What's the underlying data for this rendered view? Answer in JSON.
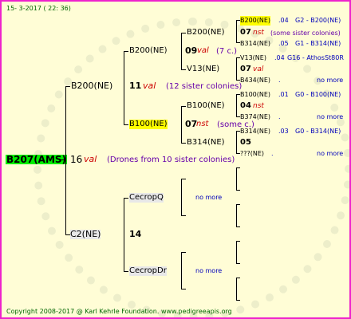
{
  "header": {
    "date": "15- 3-2017 ( 22: 36)"
  },
  "footer": {
    "copyright": "Copyright 2008-2017 @ Karl Kehrle Foundation.   www.pedigreeapis.org"
  },
  "root": {
    "id": "B207(AMS)",
    "num": "16",
    "tag": "val",
    "note": "(Drones from 10 sister colonies)"
  },
  "sire": {
    "id": "B200(NE)",
    "num": "11",
    "tag": "val",
    "note": "(12 sister colonies)"
  },
  "dam": {
    "id": "C2(NE)",
    "num": "14"
  },
  "sire_sire": {
    "id": "B200(NE)",
    "num": "09",
    "tag": "val",
    "note": "(7 c.)"
  },
  "sire_dam": {
    "id": "B100(NE)",
    "num": "07",
    "tag": "nst",
    "note": "(some c.)"
  },
  "dam_sire": {
    "id": "CecropQ",
    "more": "no more"
  },
  "dam_dam": {
    "id": "CecropDr",
    "more": "no more"
  },
  "g3": {
    "a": "B200(NE)",
    "a_line": "07",
    "a_tag": "nst",
    "a_note": "(some sister colonies)",
    "b": "V13(NE)",
    "c": "B100(NE)",
    "c_line": "04",
    "c_tag": "nst",
    "d": "B314(NE)",
    "d_line": "05"
  },
  "g4": [
    {
      "id": "B200(NE)",
      "year": ".04",
      "right": "G2 - B200(NE)"
    },
    {
      "id": "B314(NE)",
      "year": ".05",
      "right": "G1 - B314(NE)"
    },
    {
      "id": "V13(NE)",
      "year": ".04",
      "right": "G16 - AthosSt80R"
    },
    {
      "id": "B434(NE)",
      "year": ".",
      "right": "no more"
    },
    {
      "id": "B100(NE)",
      "year": ".01",
      "right": "G0 - B100(NE)"
    },
    {
      "id": "B374(NE)",
      "year": ".",
      "right": "no more"
    },
    {
      "id": "B314(NE)",
      "year": ".03",
      "right": "G0 - B314(NE)"
    },
    {
      "id": "???(NE)",
      "year": ".",
      "right": "no more"
    }
  ],
  "g4_v13_line": "07",
  "g4_v13_tag": "val",
  "colors": {
    "border": "#ee22cc",
    "background": "#fffdd6",
    "highlight_root": "#00ee00",
    "highlight_node": "#ffff00",
    "link_text": "#0000bb"
  }
}
